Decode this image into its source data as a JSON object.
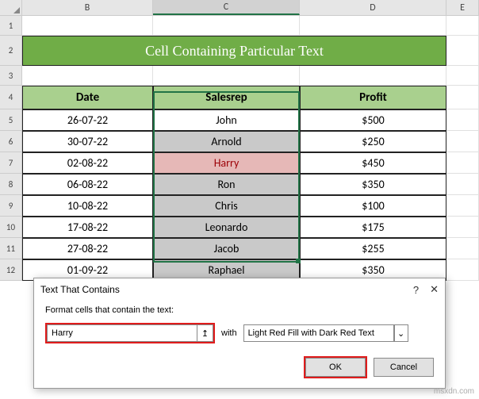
{
  "columns": {
    "B": "B",
    "C": "C",
    "D": "D",
    "E": "E"
  },
  "rows": [
    "1",
    "2",
    "3",
    "4",
    "5",
    "6",
    "7",
    "8",
    "9",
    "10",
    "11",
    "12"
  ],
  "title": "Cell Containing Particular Text",
  "headers": {
    "date": "Date",
    "salesrep": "Salesrep",
    "profit": "Profit"
  },
  "tableData": [
    {
      "date": "26-07-22",
      "salesrep": "John",
      "profit": "$500"
    },
    {
      "date": "30-07-22",
      "salesrep": "Arnold",
      "profit": "$250"
    },
    {
      "date": "02-08-22",
      "salesrep": "Harry",
      "profit": "$450"
    },
    {
      "date": "06-08-22",
      "salesrep": "Ron",
      "profit": "$350"
    },
    {
      "date": "10-08-22",
      "salesrep": "Chris",
      "profit": "$100"
    },
    {
      "date": "17-08-22",
      "salesrep": "Leonardo",
      "profit": "$175"
    },
    {
      "date": "27-08-22",
      "salesrep": "Jacob",
      "profit": "$255"
    },
    {
      "date": "01-09-22",
      "salesrep": "Raphael",
      "profit": "$350"
    }
  ],
  "highlightMatch": "Harry",
  "dialog": {
    "title": "Text That Contains",
    "help": "?",
    "close": "✕",
    "label": "Format cells that contain the text:",
    "textValue": "Harry",
    "picker": "↥",
    "withLabel": "with",
    "formatOption": "Light Red Fill with Dark Red Text",
    "dropdown": "⌄",
    "ok": "OK",
    "cancel": "Cancel"
  },
  "watermark": "msxdn.com"
}
